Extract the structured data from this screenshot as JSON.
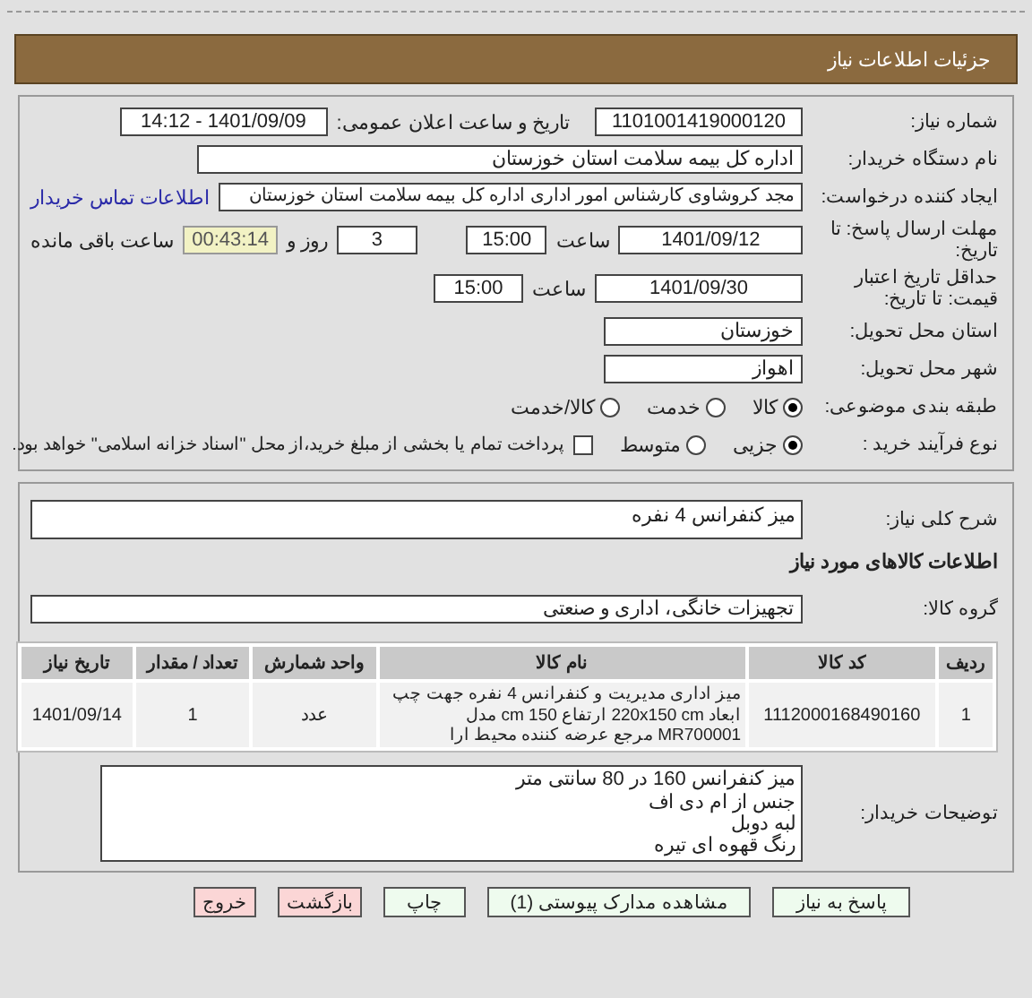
{
  "header": {
    "title": "جزئیات اطلاعات نیاز"
  },
  "need_number": {
    "label": "شماره نیاز:",
    "value": "1101001419000120"
  },
  "announce": {
    "label": "تاریخ و ساعت اعلان عمومی:",
    "value": "1401/09/09 - 14:12"
  },
  "buyer": {
    "label": "نام دستگاه خریدار:",
    "value": "اداره کل بیمه سلامت استان خوزستان"
  },
  "creator": {
    "label": "ایجاد کننده درخواست:",
    "value": "مجد کروشاوی کارشناس امور اداری اداره کل بیمه سلامت استان خوزستان",
    "link": "اطلاعات تماس خریدار"
  },
  "deadline": {
    "label": "مهلت ارسال پاسخ: تا تاریخ:",
    "date": "1401/09/12",
    "time_label": "ساعت",
    "time": "15:00",
    "days": "3",
    "days_label": "روز و",
    "remaining": "00:43:14",
    "remaining_label": "ساعت باقی مانده"
  },
  "validity": {
    "label": "حداقل تاریخ اعتبار قیمت: تا تاریخ:",
    "date": "1401/09/30",
    "time_label": "ساعت",
    "time": "15:00"
  },
  "province": {
    "label": "استان محل تحویل:",
    "value": "خوزستان"
  },
  "city": {
    "label": "شهر محل تحویل:",
    "value": "اهواز"
  },
  "category": {
    "label": "طبقه بندی موضوعی:",
    "options": [
      {
        "label": "کالا",
        "selected": true
      },
      {
        "label": "خدمت",
        "selected": false
      },
      {
        "label": "کالا/خدمت",
        "selected": false
      }
    ]
  },
  "process": {
    "label": "نوع فرآیند خرید :",
    "options": [
      {
        "label": "جزیی",
        "selected": true
      },
      {
        "label": "متوسط",
        "selected": false
      }
    ],
    "treasury": {
      "label": "پرداخت تمام یا بخشی از مبلغ خرید،از محل \"اسناد خزانه اسلامی\" خواهد بود.",
      "checked": false
    }
  },
  "description": {
    "label": "شرح کلی نیاز:",
    "value": "میز کنفرانس 4 نفره"
  },
  "goods_heading": "اطلاعات کالاهای مورد نیاز",
  "goods_group": {
    "label": "گروه کالا:",
    "value": "تجهیزات خانگی، اداری و صنعتی"
  },
  "table": {
    "columns": [
      "ردیف",
      "کد کالا",
      "نام کالا",
      "واحد شمارش",
      "تعداد / مقدار",
      "تاریخ نیاز"
    ],
    "rows": [
      [
        "1",
        "1112000168490160",
        "میز اداری مدیریت و کنفرانس 4 نفره جهت چپ ابعاد 220x150 cm ارتفاع 150 cm مدل MR700001 مرجع عرضه کننده محیط ارا",
        "عدد",
        "1",
        "1401/09/14"
      ]
    ]
  },
  "buyer_notes": {
    "label": "توضیحات خریدار:",
    "lines": [
      "میز کنفرانس 160 در 80 سانتی متر",
      "جنس از ام دی اف",
      "لبه دوبل",
      "رنگ قهوه ای تیره"
    ]
  },
  "buttons": [
    {
      "label": "پاسخ به نیاز",
      "kind": "action"
    },
    {
      "label": "مشاهده مدارک پیوستی (1)",
      "kind": "action"
    },
    {
      "label": "چاپ",
      "kind": "action"
    },
    {
      "label": "بازگشت",
      "kind": "exit"
    },
    {
      "label": "خروج",
      "kind": "exit"
    }
  ]
}
